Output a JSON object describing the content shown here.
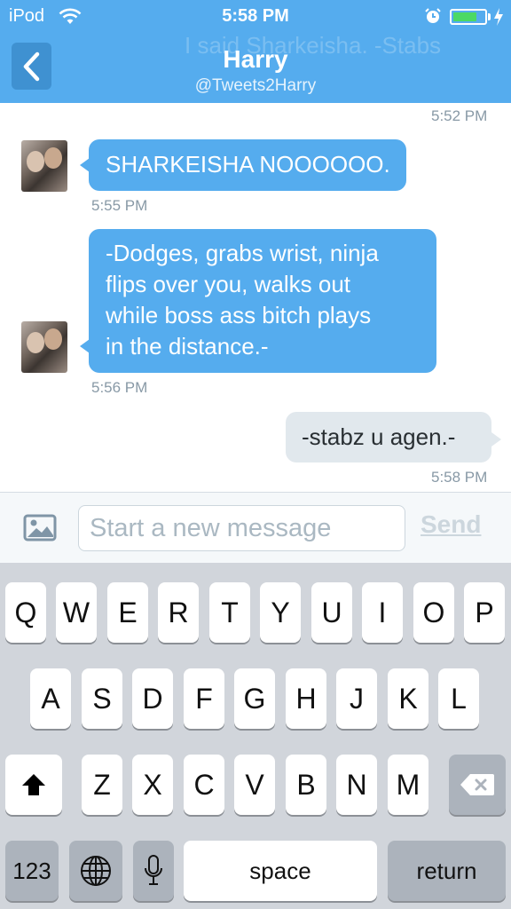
{
  "status_bar": {
    "carrier": "iPod",
    "time": "5:58 PM",
    "battery_level": 0.75,
    "icons": [
      "wifi-icon",
      "alarm-icon",
      "battery-icon",
      "charging-icon"
    ]
  },
  "header": {
    "title": "Harry",
    "handle": "@Tweets2Harry",
    "ghost_text": "I said Sharkeisha. -Stabs",
    "back_icon": "chevron-left-icon",
    "background_color": "#55acee"
  },
  "messages": {
    "top_timestamp": "5:52 PM",
    "items": [
      {
        "direction": "incoming",
        "text": "SHARKEISHA NOOOOOO.",
        "time": "5:55 PM"
      },
      {
        "direction": "incoming",
        "lines": [
          "-Dodges, grabs wrist, ninja",
          "flips over you, walks out",
          "while boss ass bitch plays",
          "in the distance.-"
        ],
        "time": "5:56 PM"
      },
      {
        "direction": "outgoing",
        "text": "-stabz u agen.-",
        "time": "5:58 PM"
      }
    ]
  },
  "composer": {
    "placeholder": "Start a new message",
    "value": "",
    "send_label": "Send",
    "photo_icon": "photo-icon"
  },
  "keyboard": {
    "row1": [
      "Q",
      "W",
      "E",
      "R",
      "T",
      "Y",
      "U",
      "I",
      "O",
      "P"
    ],
    "row2": [
      "A",
      "S",
      "D",
      "F",
      "G",
      "H",
      "J",
      "K",
      "L"
    ],
    "row3": [
      "Z",
      "X",
      "C",
      "V",
      "B",
      "N",
      "M"
    ],
    "numbers_label": "123",
    "space_label": "space",
    "return_label": "return",
    "icons": [
      "shift-icon",
      "backspace-icon",
      "globe-icon",
      "microphone-icon"
    ]
  },
  "colors": {
    "accent": "#55acee",
    "incoming_bubble": "#55acee",
    "outgoing_bubble": "#e1e8ed",
    "timestamp": "#8899a6",
    "keyboard_bg": "#d1d5db"
  }
}
